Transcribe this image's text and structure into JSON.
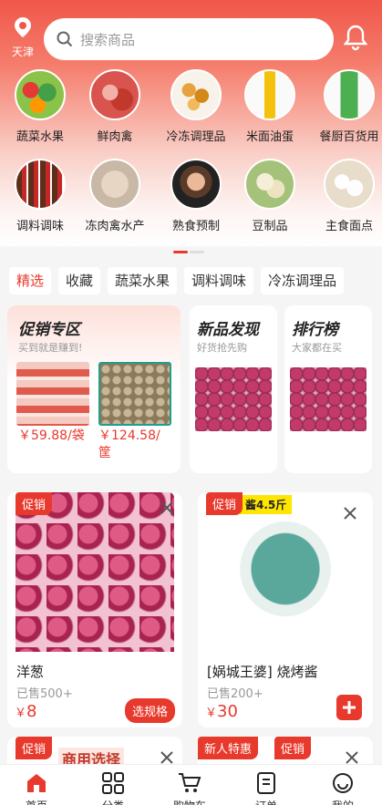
{
  "header": {
    "city": "天津",
    "search_placeholder": "搜索商品"
  },
  "categories": [
    {
      "label": "蔬菜水果",
      "icon": "vegetables-fruits-icon"
    },
    {
      "label": "鲜肉禽",
      "icon": "fresh-meat-icon"
    },
    {
      "label": "冷冻调理品",
      "icon": "frozen-food-icon"
    },
    {
      "label": "米面油蛋",
      "icon": "rice-oil-icon"
    },
    {
      "label": "餐厨百货用",
      "icon": "kitchen-goods-icon"
    },
    {
      "label": "调料调味",
      "icon": "seasoning-icon"
    },
    {
      "label": "冻肉禽水产",
      "icon": "frozen-meat-icon"
    },
    {
      "label": "熟食预制",
      "icon": "cooked-food-icon"
    },
    {
      "label": "豆制品",
      "icon": "tofu-icon"
    },
    {
      "label": "主食面点",
      "icon": "staple-food-icon"
    }
  ],
  "chips": [
    "精选",
    "收藏",
    "蔬菜水果",
    "调料调味",
    "冷冻调理品"
  ],
  "promo": {
    "title": "促销专区",
    "subtitle": "买到就是赚到!",
    "items": [
      {
        "price": "￥59.88/袋"
      },
      {
        "price": "￥124.58/筐"
      }
    ]
  },
  "new_items": {
    "title": "新品发现",
    "subtitle": "好货抢先购"
  },
  "ranking": {
    "title": "排行榜",
    "subtitle": "大家都在买"
  },
  "products": [
    {
      "tag": "促销",
      "name": "洋葱",
      "sold": "已售500+",
      "currency": "￥",
      "price": "8",
      "button": "选规格"
    },
    {
      "tag": "促销",
      "name": "[娲城王婆] 烧烤酱",
      "sold": "已售200+",
      "currency": "￥",
      "price": "30",
      "banner": "酱4.5斤"
    }
  ],
  "bottom_row": {
    "tag_left": "促销",
    "tag_new": "新人特惠",
    "tag_right": "促销",
    "partial_text": "商用选择"
  },
  "nav": [
    "首页",
    "分类",
    "购物车",
    "订单",
    "我的"
  ],
  "colors": {
    "accent": "#e8392d"
  }
}
